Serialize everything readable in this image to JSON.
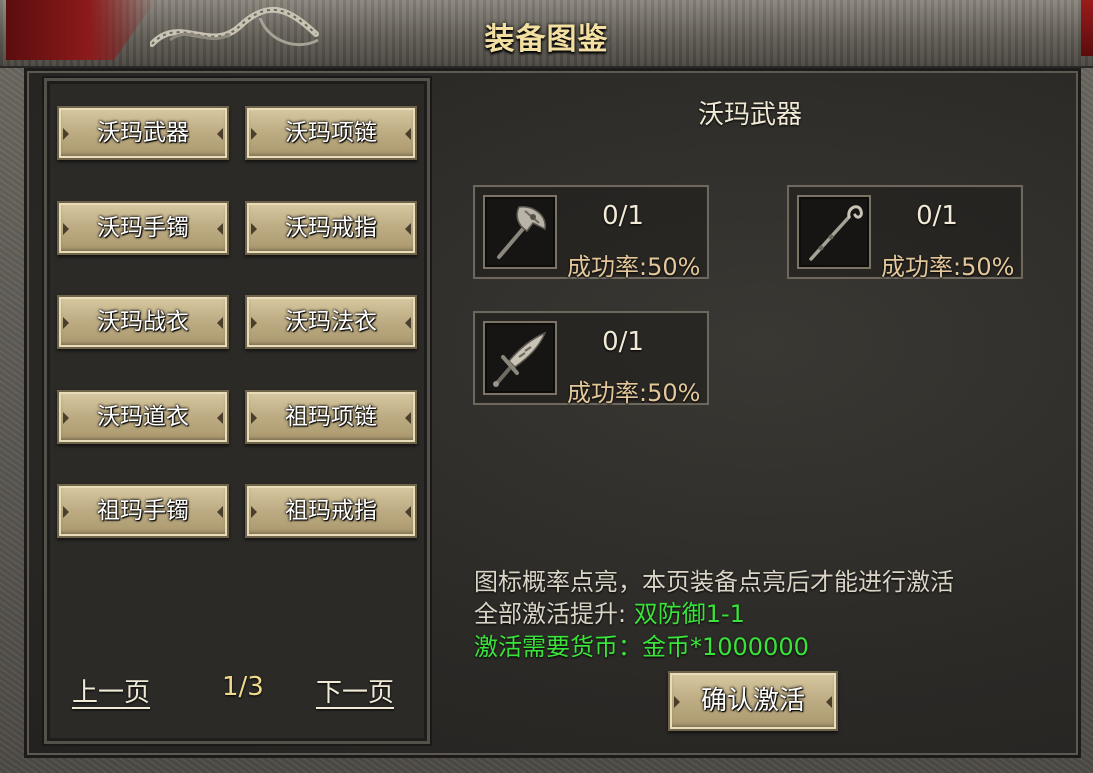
{
  "window": {
    "title": "装备图鉴"
  },
  "categories": [
    {
      "label": "沃玛武器",
      "icon": "arrow-icon"
    },
    {
      "label": "沃玛项链",
      "icon": "arrow-icon"
    },
    {
      "label": "沃玛手镯",
      "icon": "arrow-icon"
    },
    {
      "label": "沃玛戒指",
      "icon": "arrow-icon"
    },
    {
      "label": "沃玛战衣",
      "icon": "arrow-icon"
    },
    {
      "label": "沃玛法衣",
      "icon": "arrow-icon"
    },
    {
      "label": "沃玛道衣",
      "icon": "arrow-icon"
    },
    {
      "label": "祖玛项链",
      "icon": "arrow-icon"
    },
    {
      "label": "祖玛手镯",
      "icon": "arrow-icon"
    },
    {
      "label": "祖玛戒指",
      "icon": "arrow-icon"
    }
  ],
  "pager": {
    "prev_label": "上一页",
    "page": "1/3",
    "next_label": "下一页"
  },
  "detail": {
    "title": "沃玛武器",
    "items": [
      {
        "name": "axe-icon",
        "count": "0/1",
        "rate": "成功率:50%"
      },
      {
        "name": "staff-icon",
        "count": "0/1",
        "rate": "成功率:50%"
      },
      {
        "name": "sword-icon",
        "count": "0/1",
        "rate": "成功率:50%"
      }
    ]
  },
  "info": {
    "hint": "图标概率点亮，本页装备点亮后才能进行激活",
    "bonus_label": "全部激活提升:",
    "bonus_value": "双防御1-1",
    "cost_text": "激活需要货币：金币*1000000"
  },
  "actions": {
    "confirm_label": "确认激活"
  },
  "colors": {
    "title": "#f3dfa2",
    "highlight_green": "#39e33a",
    "rate": "#e3c79a",
    "button_face": "#bfae85"
  }
}
